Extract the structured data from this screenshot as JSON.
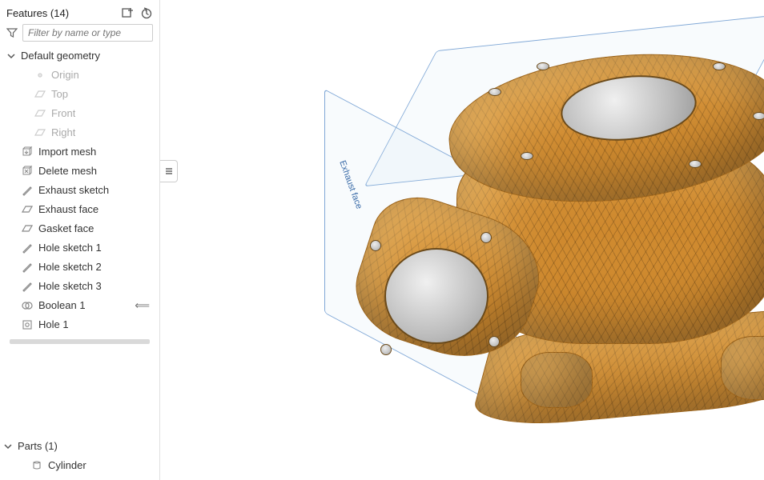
{
  "sidebar": {
    "title": "Features (14)",
    "filter_placeholder": "Filter by name or type",
    "tree": {
      "default_geometry": {
        "label": "Default geometry"
      },
      "origin": {
        "label": "Origin"
      },
      "top": {
        "label": "Top"
      },
      "front": {
        "label": "Front"
      },
      "right": {
        "label": "Right"
      },
      "import_mesh": {
        "label": "Import mesh"
      },
      "delete_mesh": {
        "label": "Delete mesh"
      },
      "exhaust_sketch": {
        "label": "Exhaust sketch"
      },
      "exhaust_face": {
        "label": "Exhaust face"
      },
      "gasket_face": {
        "label": "Gasket face"
      },
      "hole_sketch_1": {
        "label": "Hole sketch 1"
      },
      "hole_sketch_2": {
        "label": "Hole sketch 2"
      },
      "hole_sketch_3": {
        "label": "Hole sketch 3"
      },
      "boolean_1": {
        "label": "Boolean 1"
      },
      "hole_1": {
        "label": "Hole 1"
      }
    },
    "parts_title": "Parts (1)",
    "parts": {
      "cylinder": {
        "label": "Cylinder"
      }
    }
  },
  "viewport": {
    "plane_label": "Exhaust face"
  }
}
